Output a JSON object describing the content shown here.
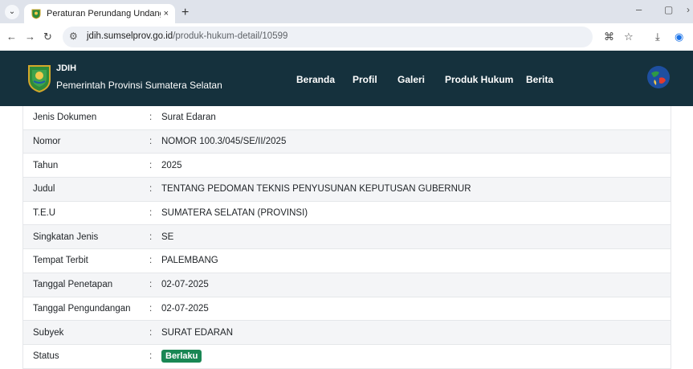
{
  "browser": {
    "tab_title": "Peraturan Perundang Undanga",
    "tab_close": "×",
    "new_tab": "+",
    "url_host": "jdih.sumselprov.go.id",
    "url_path": "/produk-hukum-detail/10599",
    "window_controls": {
      "minimize": "–",
      "maximize": "▢",
      "close": "›"
    }
  },
  "site": {
    "brand_title": "JDIH",
    "brand_subtitle": "Pemerintah Provinsi Sumatera Selatan",
    "nav": [
      "Beranda",
      "Profil",
      "Galeri",
      "Produk Hukum",
      "Berita"
    ]
  },
  "details": [
    {
      "label": "Jenis Dokumen",
      "value": "Surat Edaran"
    },
    {
      "label": "Nomor",
      "value": "NOMOR 100.3/045/SE/II/2025"
    },
    {
      "label": "Tahun",
      "value": "2025"
    },
    {
      "label": "Judul",
      "value": "TENTANG PEDOMAN TEKNIS PENYUSUNAN KEPUTUSAN GUBERNUR"
    },
    {
      "label": "T.E.U",
      "value": "SUMATERA SELATAN (PROVINSI)"
    },
    {
      "label": "Singkatan Jenis",
      "value": "SE"
    },
    {
      "label": "Tempat Terbit",
      "value": "PALEMBANG"
    },
    {
      "label": "Tanggal Penetapan",
      "value": "02-07-2025"
    },
    {
      "label": "Tanggal Pengundangan",
      "value": "02-07-2025"
    },
    {
      "label": "Subyek",
      "value": "SURAT EDARAN"
    },
    {
      "label": "Status",
      "value": "Berlaku"
    }
  ],
  "colon": ":",
  "colors": {
    "header_bg": "#15313d",
    "badge_bg": "#198754"
  }
}
